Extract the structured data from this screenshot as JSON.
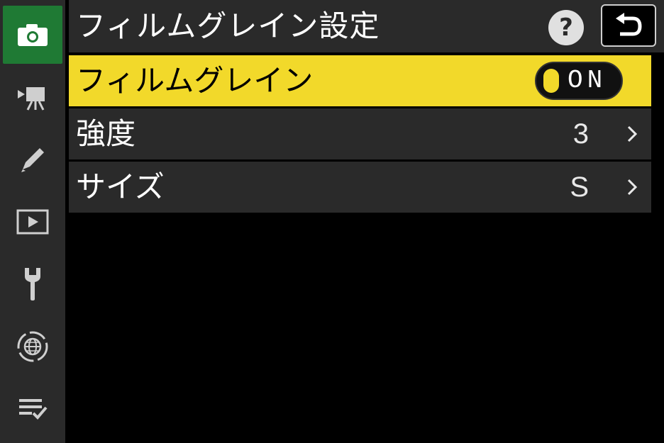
{
  "header": {
    "title": "フィルムグレイン設定",
    "help_label": "?"
  },
  "sidebar": {
    "items": [
      {
        "icon": "camera-icon",
        "active": true
      },
      {
        "icon": "movie-camera-icon",
        "active": false
      },
      {
        "icon": "pencil-icon",
        "active": false
      },
      {
        "icon": "playback-icon",
        "active": false
      },
      {
        "icon": "wrench-icon",
        "active": false
      },
      {
        "icon": "network-icon",
        "active": false
      },
      {
        "icon": "my-menu-icon",
        "active": false
      }
    ]
  },
  "menu": {
    "items": [
      {
        "label": "フィルムグレイン",
        "value": "ON",
        "control": "toggle",
        "selected": true
      },
      {
        "label": "強度",
        "value": "3",
        "control": "submenu",
        "selected": false
      },
      {
        "label": "サイズ",
        "value": "S",
        "control": "submenu",
        "selected": false
      }
    ]
  },
  "colors": {
    "active_tab": "#1f7a34",
    "highlight": "#f2d92a",
    "panel": "#2a2a2a",
    "background": "#000000"
  }
}
